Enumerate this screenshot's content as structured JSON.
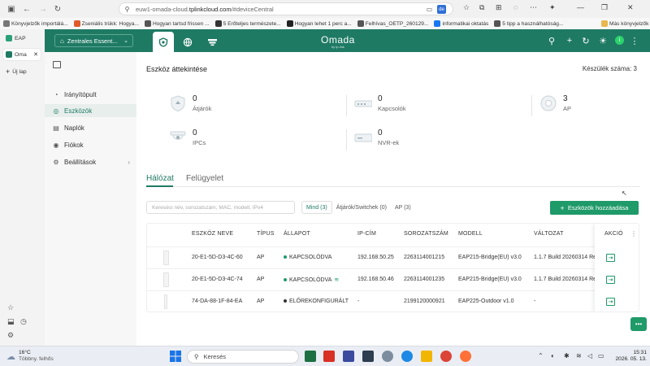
{
  "browser": {
    "url_prefix": "euw1-omada-cloud.",
    "url_host": "tplinkcloud.com",
    "url_path": "/#deviceCentral",
    "translate_badge": "de",
    "bookmarks": [
      {
        "label": "Könyvjelzők importálá...",
        "color": "#777"
      },
      {
        "label": "Zseniális trükk: Hogya...",
        "color": "#e05a2a"
      },
      {
        "label": "Hogyan tartsd frissen ...",
        "color": "#555"
      },
      {
        "label": "5 Erőteljes természete...",
        "color": "#333"
      },
      {
        "label": "Hogyan lehet 1 perc a...",
        "color": "#222"
      },
      {
        "label": "Felhívas_OETP_260129...",
        "color": "#555"
      },
      {
        "label": "informatikai oktatás",
        "color": "#1877f2"
      },
      {
        "label": "5 tipp a használhatóság...",
        "color": "#555"
      }
    ],
    "other_bookmarks": "Más könyvjelzők",
    "vertical_tabs": [
      {
        "label": "EAP"
      },
      {
        "label": "Oma"
      }
    ],
    "new_tab": "Új lap"
  },
  "app": {
    "site_name": "Zentrales Essent...",
    "brand": "Omada",
    "brand_sub": "by tp-link",
    "avatar_letter": "I",
    "accent": "#1f7a64",
    "nav": [
      {
        "label": "Irányítópult",
        "icon": "dashboard-icon",
        "glyph": "◔"
      },
      {
        "label": "Eszközök",
        "icon": "devices-icon",
        "glyph": "◎"
      },
      {
        "label": "Naplók",
        "icon": "logs-icon",
        "glyph": "▤"
      },
      {
        "label": "Fiókok",
        "icon": "accounts-icon",
        "glyph": "◉"
      },
      {
        "label": "Beállítások",
        "icon": "settings-icon",
        "glyph": "⚙"
      }
    ],
    "overview_title": "Eszköz áttekintése",
    "device_count_label": "Készülék száma:",
    "device_count": "3",
    "stats": [
      {
        "value": "0",
        "label": "Átjárók",
        "icon": "gateway-icon"
      },
      {
        "value": "0",
        "label": "Kapcsolók",
        "icon": "switch-icon"
      },
      {
        "value": "3",
        "label": "AP",
        "icon": "ap-icon"
      },
      {
        "value": "0",
        "label": "IPCs",
        "icon": "camera-icon"
      },
      {
        "value": "0",
        "label": "NVR-ek",
        "icon": "nvr-icon"
      }
    ],
    "tabs": [
      {
        "label": "Hálózat"
      },
      {
        "label": "Felügyelet"
      }
    ],
    "search_placeholder": "Keresési név, sorozatszám, MAC, modell, IPv4",
    "filters": [
      {
        "label": "Mind (3)"
      },
      {
        "label": "Átjárók/Switchek (0)"
      },
      {
        "label": "AP (3)"
      }
    ],
    "add_button": "Eszközök hozzáadása",
    "table": {
      "headers": {
        "name": "ESZKÖZ NEVE",
        "type": "TÍPUS",
        "status": "ÁLLAPOT",
        "ip": "IP-CÍM",
        "serial": "SOROZATSZÁM",
        "model": "MODELL",
        "version": "VÁLTOZAT",
        "action": "AKCIÓ"
      },
      "rows": [
        {
          "name": "20-E1-5D-D3-4C-60",
          "type": "AP",
          "status": "KAPCSOLÓDVA",
          "status_color": "#1f9a69",
          "ip": "192.168.50.25",
          "serial": "2263114001215",
          "model": "EAP215-Bridge(EU) v3.0",
          "version": "1.1.7 Build 20260314 Rel"
        },
        {
          "name": "20-E1-5D-D3-4C-74",
          "type": "AP",
          "status": "KAPCSOLÓDVA",
          "status_color": "#1f9a69",
          "ip": "192.168.50.46",
          "serial": "2263114001235",
          "model": "EAP215-Bridge(EU) v3.0",
          "version": "1.1.7 Build 20260314 Rel"
        },
        {
          "name": "74-DA-88-1F-84-EA",
          "type": "AP",
          "status": "ELŐREKONFIGURÁLT",
          "status_color": "#333333",
          "ip": "-",
          "serial": "2199120000921",
          "model": "EAP225-Outdoor v1.0",
          "version": "-"
        }
      ]
    }
  },
  "taskbar": {
    "temperature": "16°C",
    "weather": "Többny. felhős",
    "search": "Keresés",
    "time": "15:31",
    "date": "2026. 05. 13."
  }
}
